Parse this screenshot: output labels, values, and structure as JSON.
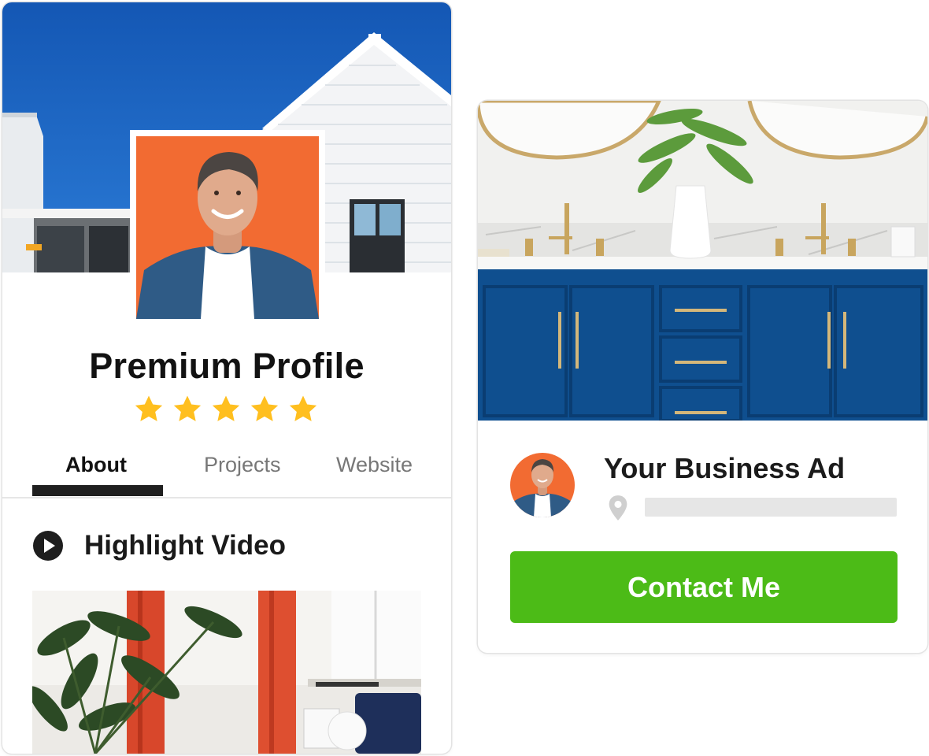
{
  "profile": {
    "title": "Premium Profile",
    "rating": 5,
    "rating_max": 5,
    "tabs": [
      {
        "label": "About",
        "active": true
      },
      {
        "label": "Projects",
        "active": false
      },
      {
        "label": "Website",
        "active": false
      }
    ],
    "highlight_label": "Highlight Video"
  },
  "ad": {
    "title": "Your Business Ad",
    "contact_label": "Contact Me"
  },
  "colors": {
    "accent_green": "#4cbb17",
    "star_gold": "#ffbf1f",
    "avatar_orange": "#f26b32",
    "sky_blue": "#1b64bd",
    "cabinet_blue": "#0f4f8f"
  },
  "icons": {
    "star": "star-icon",
    "play": "play-icon",
    "location": "location-pin-icon"
  }
}
